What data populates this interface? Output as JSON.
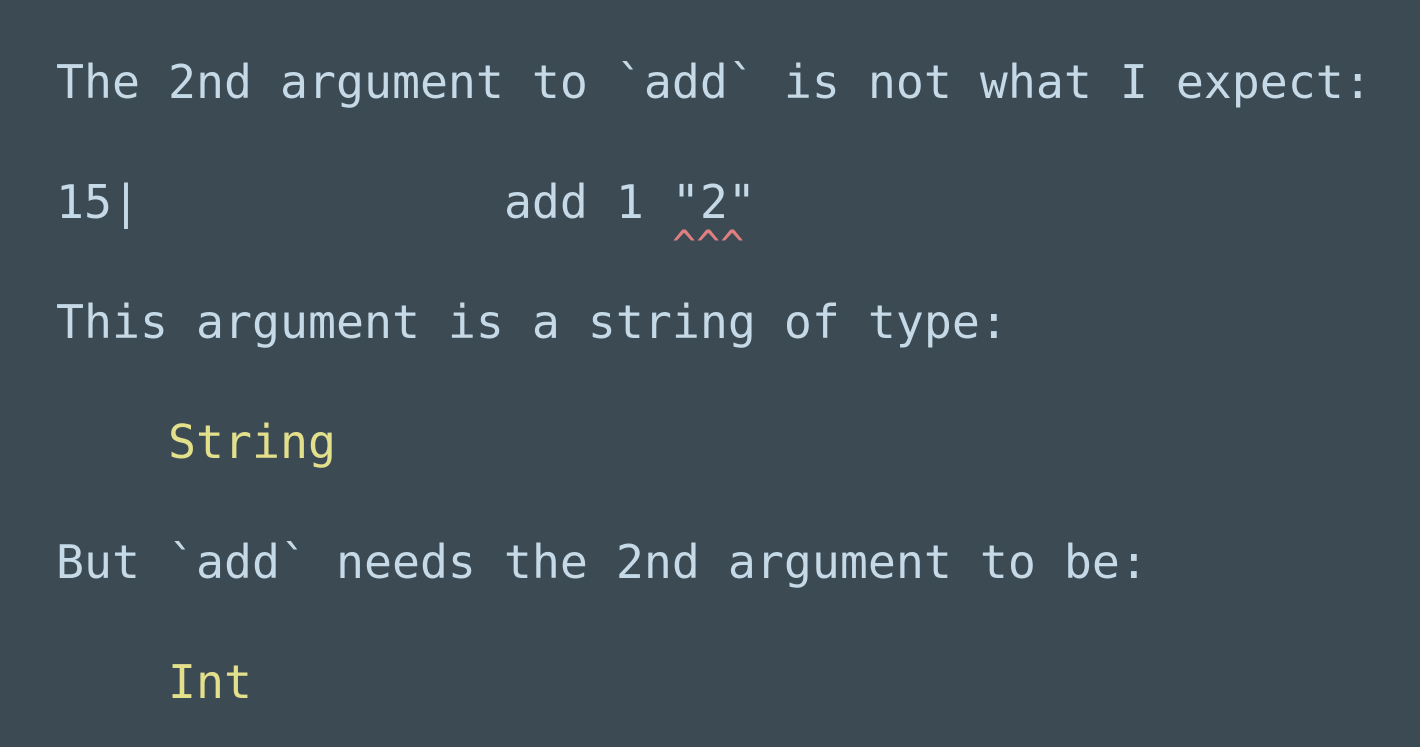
{
  "error": {
    "line1": "The 2nd argument to `add` is not what I expect:",
    "code_line_number": "15|",
    "code_text": "             add 1 \"2\"",
    "caret": "^^^",
    "line3": "This argument is a string of type:",
    "actual_type": "String",
    "line5": "But `add` needs the 2nd argument to be:",
    "expected_type": "Int"
  },
  "colors": {
    "background": "#3c4a54",
    "text": "#c5d9e6",
    "type": "#e3e08c",
    "caret": "#e07f82"
  }
}
